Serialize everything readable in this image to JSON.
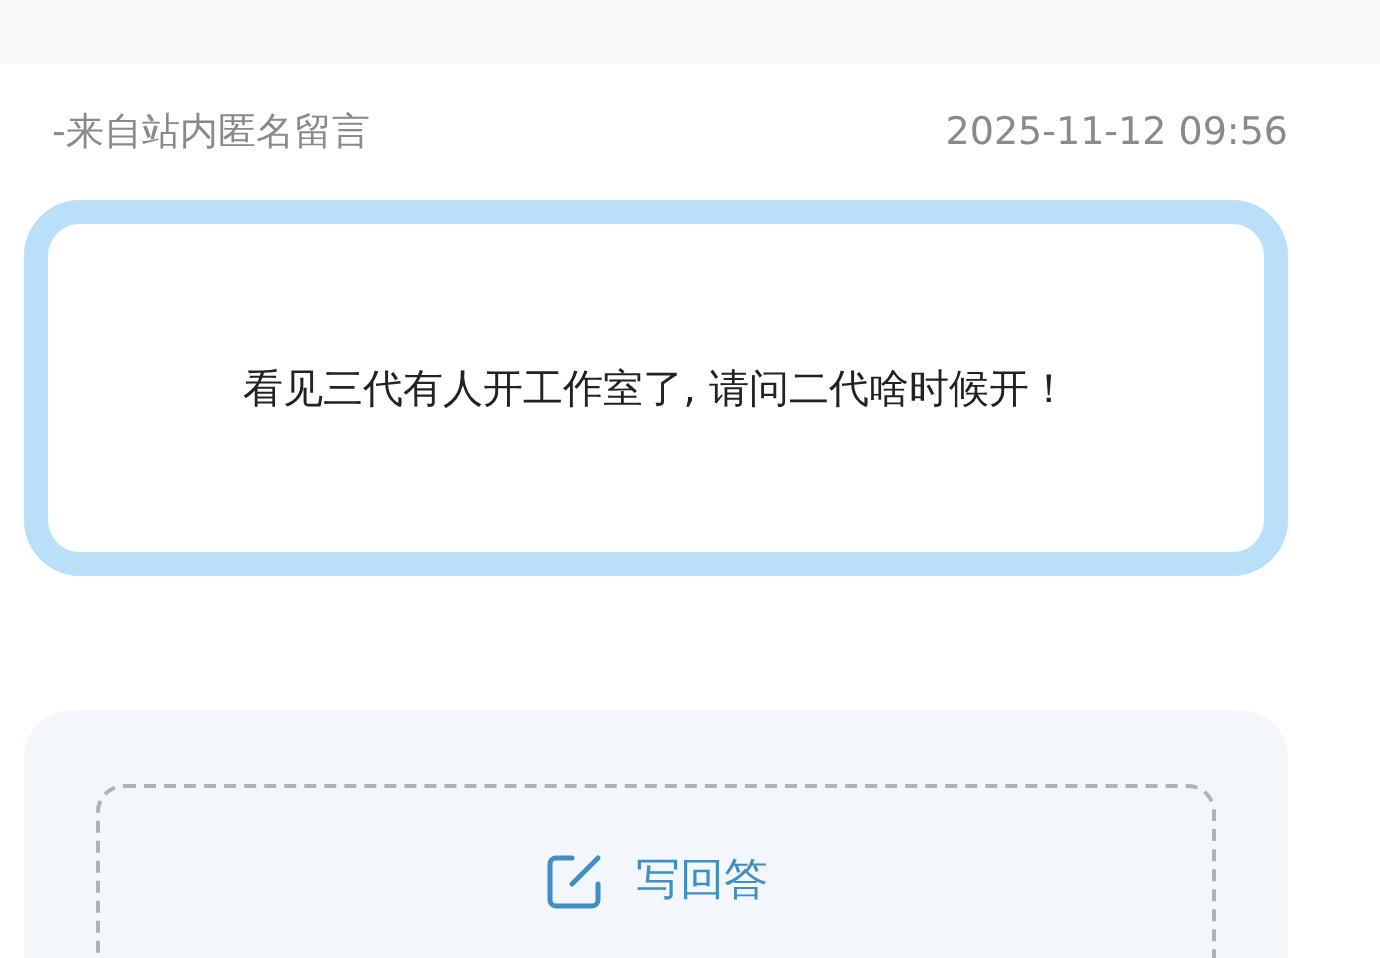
{
  "message": {
    "source": "-来自站内匿名留言",
    "time": "2025-11-12 09:56",
    "text": "看见三代有人开工作室了, 请问二代啥时候开！"
  },
  "answer": {
    "button_label": "写回答"
  }
}
